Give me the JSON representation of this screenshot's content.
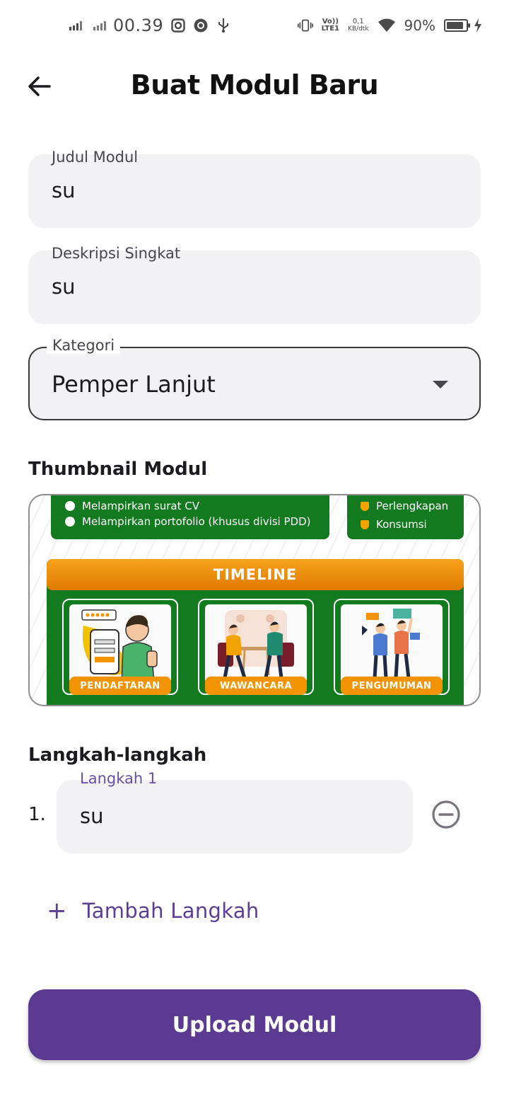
{
  "status_bar": {
    "time": "00.39",
    "volte_top": "Vo))",
    "volte_bottom": "LTE1",
    "speed_top": "0,1",
    "speed_bottom": "KB/dtk",
    "battery_percent": "90%",
    "battery_level": 0.9,
    "icons": [
      "signal-icon",
      "signal-icon",
      "instagram-icon",
      "chrome-icon",
      "usb-icon",
      "vibrate-icon",
      "wifi-icon",
      "battery-icon",
      "charging-icon"
    ]
  },
  "header": {
    "title": "Buat Modul Baru",
    "back_icon": "arrow-left-icon"
  },
  "form": {
    "judul": {
      "label": "Judul Modul",
      "value": "su"
    },
    "deskripsi": {
      "label": "Deskripsi Singkat",
      "value": "su"
    },
    "kategori": {
      "label": "Kategori",
      "value": "Pemper Lanjut"
    }
  },
  "thumbnail": {
    "title": "Thumbnail Modul",
    "image": {
      "requirements": [
        "Melampirkan surat CV",
        "Melampirkan portofolio (khusus divisi PDD)"
      ],
      "equipment": [
        "Perlengkapan",
        "Konsumsi"
      ],
      "timeline_title": "TIMELINE",
      "stages": [
        "PENDAFTARAN",
        "WAWANCARA",
        "PENGUMUMAN"
      ],
      "colors": {
        "green": "#137a1f",
        "orange": "#f29400"
      }
    }
  },
  "steps": {
    "title": "Langkah-langkah",
    "items": [
      {
        "number": "1.",
        "label": "Langkah 1",
        "value": "su"
      }
    ],
    "add_label": "Tambah Langkah"
  },
  "actions": {
    "upload_label": "Upload Modul"
  },
  "colors": {
    "primary": "#5b3a92",
    "accent_text": "#6750a4",
    "field_bg": "#f2f2f4"
  }
}
